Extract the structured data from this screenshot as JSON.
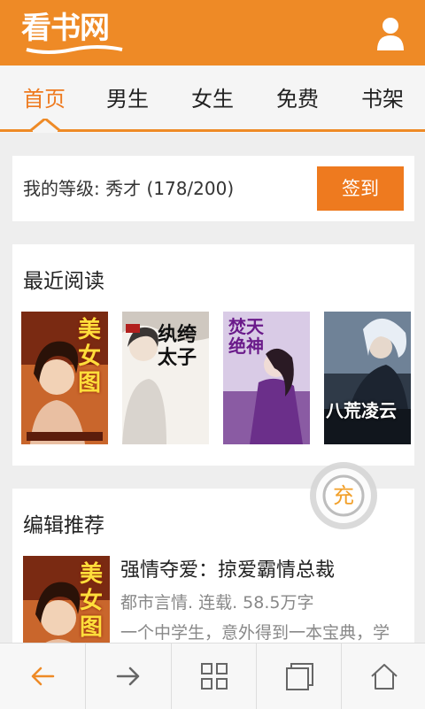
{
  "header": {
    "logo_text": "看书网"
  },
  "tabs": [
    {
      "label": "首页",
      "active": true
    },
    {
      "label": "男生"
    },
    {
      "label": "女生"
    },
    {
      "label": "免费"
    },
    {
      "label": "书架"
    }
  ],
  "level": {
    "text": "我的等级: 秀才 (178/200)",
    "checkin_label": "签到"
  },
  "recent": {
    "title": "最近阅读",
    "books": [
      {
        "cover_title": "美女图"
      },
      {
        "cover_title": "纨绔太子"
      },
      {
        "cover_title": "焚天绝神"
      },
      {
        "cover_title": "八荒凌云"
      }
    ]
  },
  "editor": {
    "title": "编辑推荐",
    "book_title": "强情夺爱：掠爱霸情总裁",
    "book_meta": "都市言情. 连载. 58.5万字",
    "book_desc": "一个中学生，意外得到一本宝典，学",
    "cover_title": "美女图"
  },
  "float_button": {
    "label": "充"
  },
  "colors": {
    "accent": "#ee8a26",
    "accent_text": "#ee7a1f"
  },
  "icons": {
    "user": "user-icon",
    "back": "arrow-left-icon",
    "forward": "arrow-right-icon",
    "grid": "grid-icon",
    "windows": "windows-icon",
    "home": "home-icon"
  }
}
